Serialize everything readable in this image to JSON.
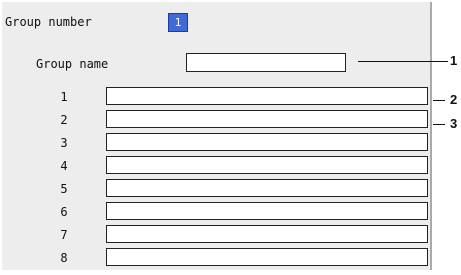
{
  "group": {
    "number_label": "Group number",
    "number_value": "1",
    "name_label": "Group name",
    "name_value": ""
  },
  "channels": [
    {
      "label": "1",
      "value": ""
    },
    {
      "label": "2",
      "value": ""
    },
    {
      "label": "3",
      "value": ""
    },
    {
      "label": "4",
      "value": ""
    },
    {
      "label": "5",
      "value": ""
    },
    {
      "label": "6",
      "value": ""
    },
    {
      "label": "7",
      "value": ""
    },
    {
      "label": "8",
      "value": ""
    }
  ],
  "callouts": [
    "1",
    "2",
    "3"
  ],
  "colors": {
    "panel_bg": "#ededed",
    "selected_bg": "#3f6ad8",
    "field_bg": "#ffffff"
  }
}
